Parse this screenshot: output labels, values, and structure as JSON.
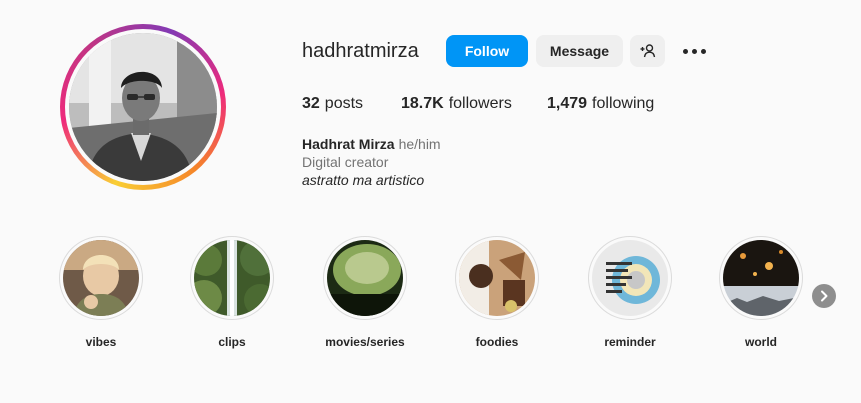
{
  "profile": {
    "username": "hadhratmirza",
    "avatar_icon": "profile-photo",
    "ring_colors": [
      "#f9ce34",
      "#ee2a7b",
      "#6228d7"
    ]
  },
  "actions": {
    "follow_label": "Follow",
    "message_label": "Message",
    "add_user_icon": "person-plus-icon",
    "more_icon": "ellipsis-icon"
  },
  "stats": {
    "posts_count": "32",
    "posts_label": "posts",
    "followers_count": "18.7K",
    "followers_label": "followers",
    "following_count": "1,479",
    "following_label": "following"
  },
  "bio": {
    "name": "Hadhrat Mirza",
    "pronouns": "he/him",
    "category": "Digital creator",
    "tagline": "astratto ma artistico"
  },
  "highlights": [
    {
      "label": "vibes"
    },
    {
      "label": "clips"
    },
    {
      "label": "movies/series"
    },
    {
      "label": "foodies"
    },
    {
      "label": "reminder"
    },
    {
      "label": "world"
    }
  ],
  "colors": {
    "follow_blue": "#0095f6",
    "button_gray": "#efefef",
    "text": "#262626",
    "secondary_text": "#737373"
  }
}
